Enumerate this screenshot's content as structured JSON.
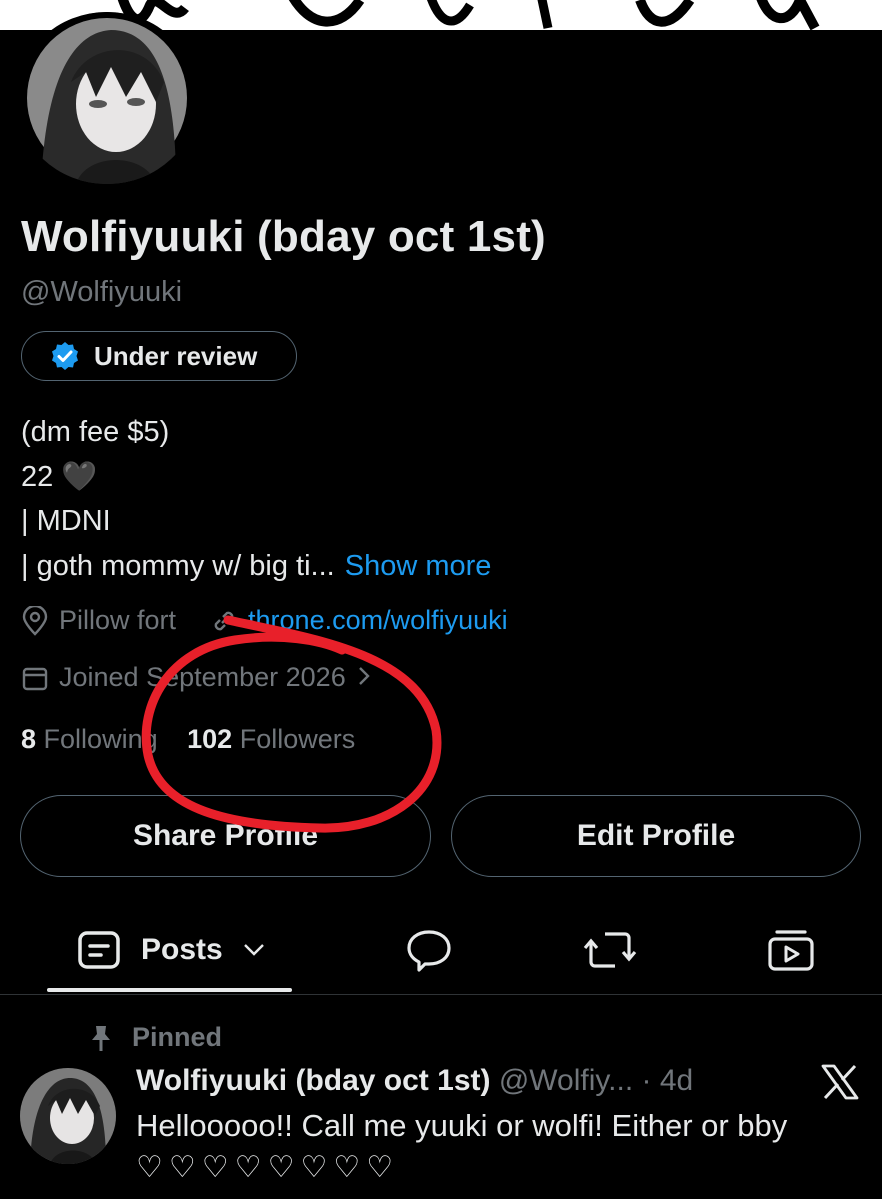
{
  "profile": {
    "display_name": "Wolfiyuuki (bday oct 1st)",
    "handle": "@Wolfiyuuki",
    "verification_label": "Under review",
    "bio_lines": [
      "(dm fee $5)",
      "22 🖤",
      "| MDNI",
      "| goth mommy w/ big ti..."
    ],
    "show_more": "Show more",
    "location": "Pillow fort",
    "website": "throne.com/wolfiyuuki",
    "joined": "Joined September 2026",
    "following_count": "8",
    "following_label": "Following",
    "followers_count": "102",
    "followers_label": "Followers"
  },
  "actions": {
    "share_profile": "Share Profile",
    "edit_profile": "Edit Profile"
  },
  "tabs": {
    "posts_label": "Posts",
    "icons": [
      "posts-icon",
      "replies-icon",
      "reposts-icon",
      "media-icon"
    ]
  },
  "post": {
    "pinned_label": "Pinned",
    "author_name": "Wolfiyuuki (bday oct 1st)",
    "author_handle": "@Wolfiy...",
    "time": "· 4d",
    "text": "Hellooooo!! Call me yuuki or wolfi! Either or bby",
    "hearts": "♡♡♡♡♡♡♡♡"
  },
  "colors": {
    "background": "#000000",
    "accent": "#1d9bf0",
    "muted": "#71767b",
    "annotation_circle": "#e8202a"
  }
}
